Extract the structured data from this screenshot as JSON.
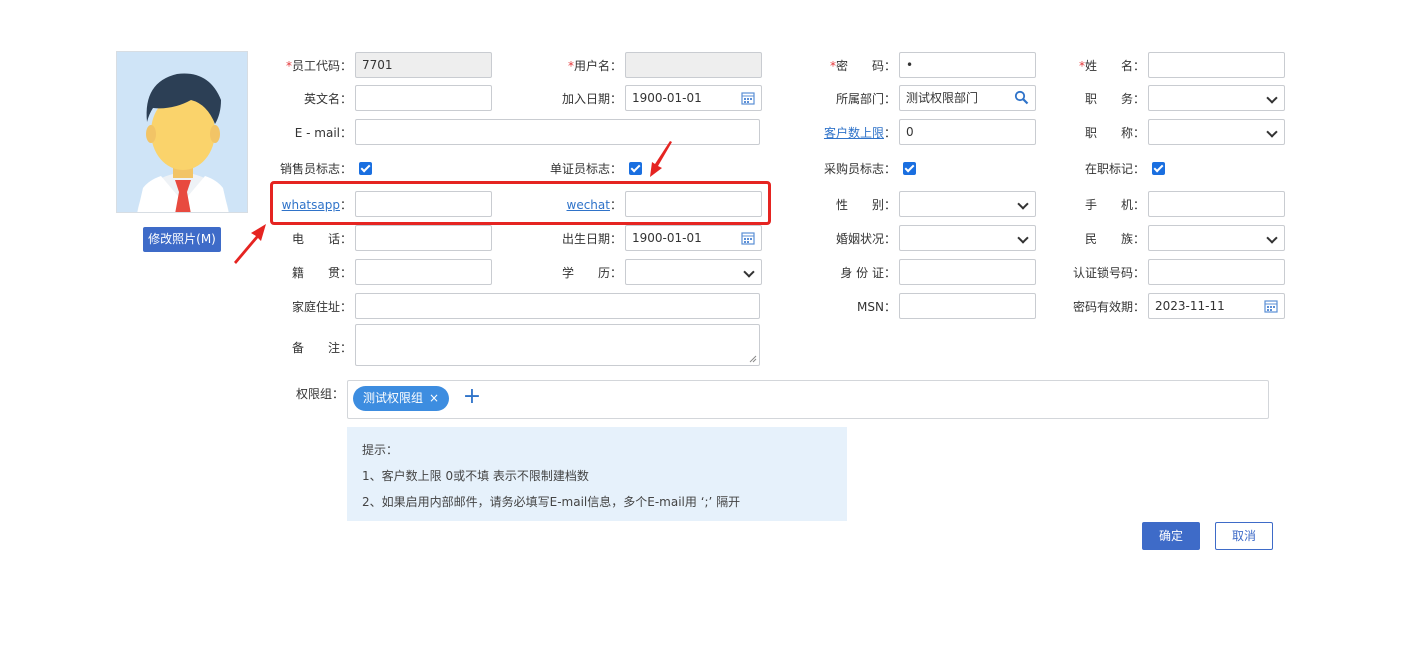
{
  "photo": {
    "change_label": "修改照片(M)"
  },
  "fields": {
    "emp_code": {
      "label": "员工代码：",
      "value": "7701"
    },
    "username": {
      "label": "用户名：",
      "value": ""
    },
    "password": {
      "label": "密　　码：",
      "value": "•"
    },
    "name": {
      "label": "姓　　名：",
      "value": ""
    },
    "english_name": {
      "label": "英文名：",
      "value": ""
    },
    "join_date": {
      "label": "加入日期：",
      "value": "1900-01-01"
    },
    "department": {
      "label": "所属部门：",
      "value": "测试权限部门"
    },
    "position": {
      "label": "职　　务：",
      "value": ""
    },
    "email": {
      "label": "E - mail：",
      "value": ""
    },
    "customer_limit": {
      "label": "客户数上限",
      "suffix": "：",
      "value": "0"
    },
    "title": {
      "label": "职　　称：",
      "value": ""
    },
    "sales_flag": {
      "label": "销售员标志：",
      "checked": true
    },
    "doc_flag": {
      "label": "单证员标志：",
      "checked": true
    },
    "purchase_flag": {
      "label": "采购员标志：",
      "checked": true
    },
    "employed_flag": {
      "label": "在职标记：",
      "checked": true
    },
    "whatsapp": {
      "label": "whatsapp",
      "suffix": "：",
      "value": ""
    },
    "wechat": {
      "label": "wechat",
      "suffix": "：",
      "value": ""
    },
    "gender": {
      "label": "性　　别：",
      "value": ""
    },
    "mobile": {
      "label": "手　　机：",
      "value": ""
    },
    "phone": {
      "label": "电　　话：",
      "value": ""
    },
    "birth_date": {
      "label": "出生日期：",
      "value": "1900-01-01"
    },
    "marital": {
      "label": "婚姻状况：",
      "value": ""
    },
    "ethnicity": {
      "label": "民　　族：",
      "value": ""
    },
    "native_place": {
      "label": "籍　　贯：",
      "value": ""
    },
    "education": {
      "label": "学　　历：",
      "value": ""
    },
    "id_card": {
      "label": "身 份 证：",
      "value": ""
    },
    "auth_lock": {
      "label": "认证锁号码：",
      "value": ""
    },
    "address": {
      "label": "家庭住址：",
      "value": ""
    },
    "msn": {
      "label": "MSN：",
      "value": ""
    },
    "pwd_expiry": {
      "label": "密码有效期：",
      "value": "2023-11-11"
    },
    "remark": {
      "label": "备　　注：",
      "value": ""
    }
  },
  "permission": {
    "label": "权限组：",
    "tags": [
      "测试权限组"
    ],
    "remove_glyph": "×",
    "add_glyph": "+"
  },
  "tips": {
    "title": "提示：",
    "lines": [
      "1、客户数上限 0或不填 表示不限制建档数",
      "2、如果启用内部邮件，请务必填写E-mail信息，多个E-mail用 ‘;’ 隔开"
    ]
  },
  "buttons": {
    "ok": "确定",
    "cancel": "取消"
  },
  "colors": {
    "primary": "#3e6bc8",
    "checkbox": "#1a6fe0",
    "highlight": "#e52421",
    "tip_bg": "#e6f1fb"
  }
}
